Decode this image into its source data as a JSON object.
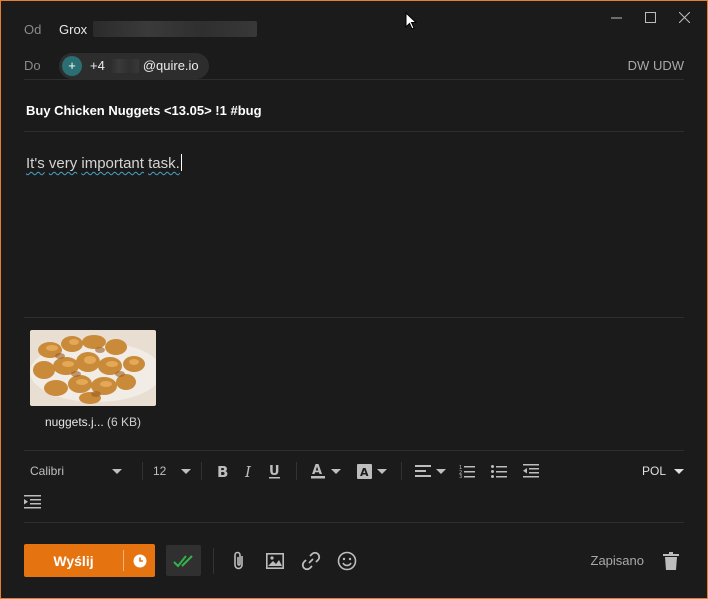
{
  "window": {
    "controls": [
      "minimize-icon",
      "maximize-icon",
      "close-icon"
    ],
    "accent_color": "#e57f2f"
  },
  "from": {
    "label": "Od",
    "name": "Grox"
  },
  "to": {
    "label": "Do",
    "chip": {
      "avatar": "+",
      "prefix": "+4",
      "suffix": "@quire.io"
    },
    "cc_bcc": "DW UDW"
  },
  "subject": "Buy Chicken Nuggets <13.05> !1 #bug",
  "body": {
    "text_part1": "It's",
    "text_part2": "very",
    "text_part3": "important",
    "text_part4": "task."
  },
  "attachment": {
    "filename": "nuggets.j...",
    "size": "(6 KB)"
  },
  "toolbar": {
    "font": "Calibri",
    "size": "12",
    "language": "POL",
    "icons": [
      "bold-icon",
      "italic-icon",
      "underline-icon",
      "font-color-icon",
      "highlight-icon",
      "align-icon",
      "numbered-list-icon",
      "bullet-list-icon",
      "decrease-indent-icon",
      "increase-indent-icon"
    ]
  },
  "bottom": {
    "send_label": "Wyślij",
    "saved_label": "Zapisano",
    "send_color": "#e5730f",
    "check_color": "#33b249"
  }
}
